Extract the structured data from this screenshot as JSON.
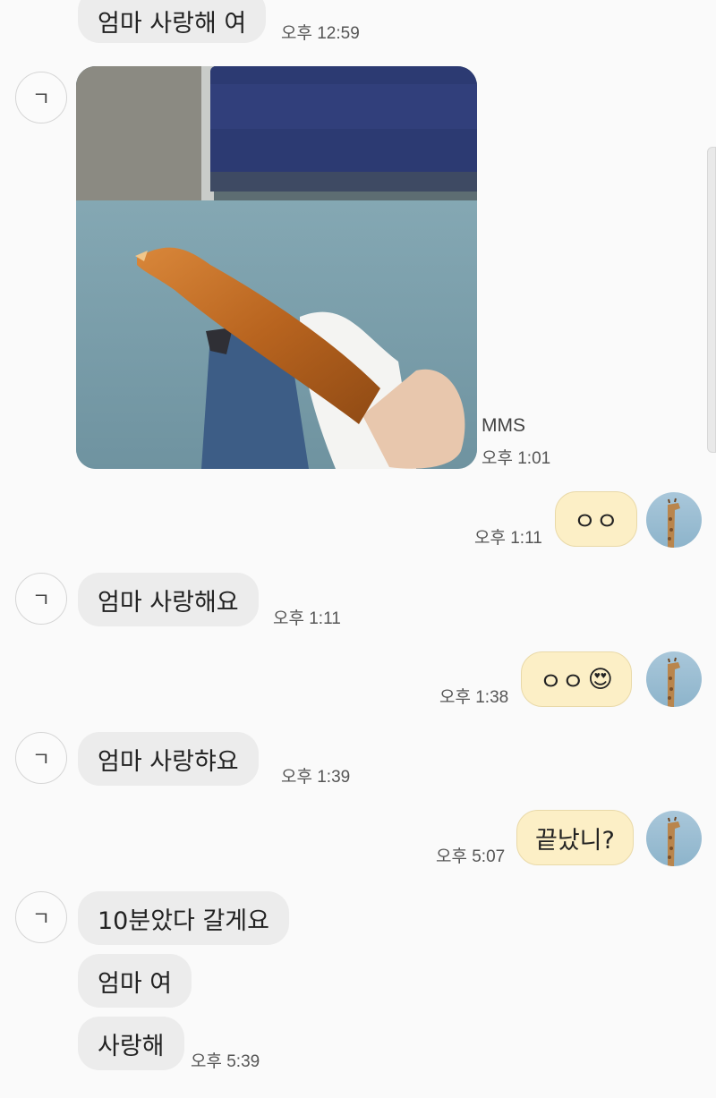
{
  "messages": {
    "m1": {
      "text": "엄마 사랑해 여",
      "time": "오후 12:59"
    },
    "m2": {
      "label": "MMS",
      "time": "오후 1:01"
    },
    "m3": {
      "text": "ㅇㅇ",
      "time": "오후 1:11"
    },
    "m4": {
      "text": "엄마 사랑해요",
      "time": "오후 1:11"
    },
    "m5": {
      "text": "ㅇㅇ",
      "emoji": "😍",
      "time": "오후 1:38"
    },
    "m6": {
      "text": "엄마 사랑햐요",
      "time": "오후 1:39"
    },
    "m7": {
      "text": "끝났니?",
      "time": "오후 5:07"
    },
    "m8": {
      "text": "10분았다 갈게요"
    },
    "m9": {
      "text": "엄마 여"
    },
    "m10": {
      "text": "사랑해",
      "time": "오후 5:39"
    }
  },
  "contact": {
    "avatar_initial": "ㄱ"
  },
  "icons": {
    "contact_avatar": "initial-avatar-icon",
    "my_avatar": "giraffe-avatar-icon"
  }
}
